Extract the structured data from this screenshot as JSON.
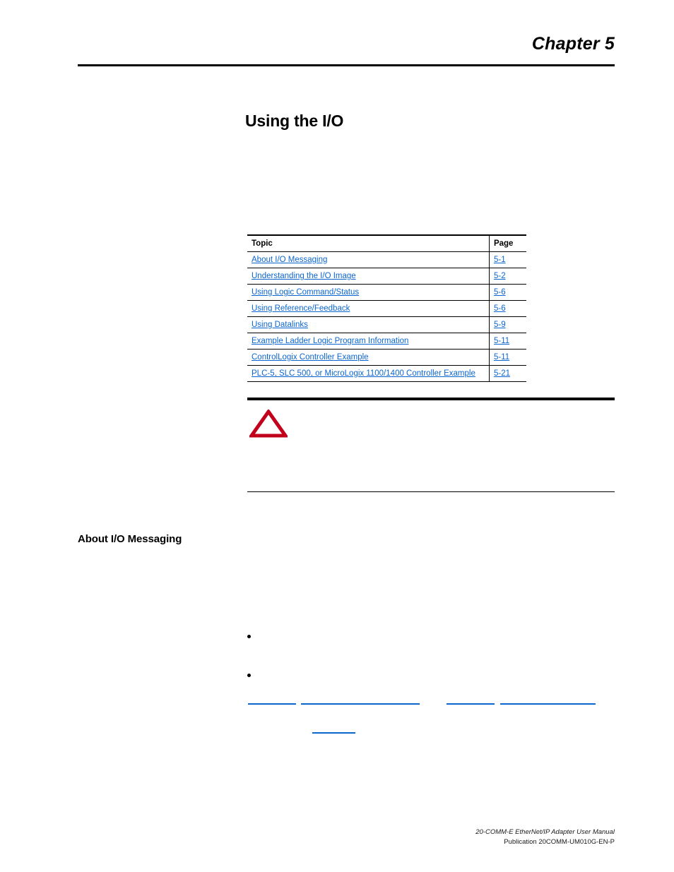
{
  "header": {
    "chapter_label": "Chapter 5"
  },
  "title": "Using the I/O",
  "topic_table": {
    "columns": [
      "Topic",
      "Page"
    ],
    "rows": [
      {
        "topic": "About I/O Messaging",
        "page": "5-1"
      },
      {
        "topic": "Understanding the I/O Image",
        "page": "5-2"
      },
      {
        "topic": "Using Logic Command/Status",
        "page": "5-6"
      },
      {
        "topic": "Using Reference/Feedback",
        "page": "5-6"
      },
      {
        "topic": "Using Datalinks",
        "page": "5-9"
      },
      {
        "topic": "Example Ladder Logic Program Information",
        "page": "5-11"
      },
      {
        "topic": "ControlLogix Controller Example",
        "page": "5-11"
      },
      {
        "topic": "PLC-5, SLC 500, or MicroLogix 1100/1400 Controller Example",
        "page": "5-21"
      }
    ]
  },
  "attention": {
    "icon": "attention-triangle-icon",
    "icon_color": "#C2001B"
  },
  "section": {
    "heading": "About I/O Messaging"
  },
  "colors": {
    "link": "#0B66D0",
    "rule": "#000000",
    "attention": "#C2001B"
  },
  "footer": {
    "manual": "20-COMM-E EtherNet/IP Adapter User Manual",
    "publication": "Publication 20COMM-UM010G-EN-P"
  }
}
